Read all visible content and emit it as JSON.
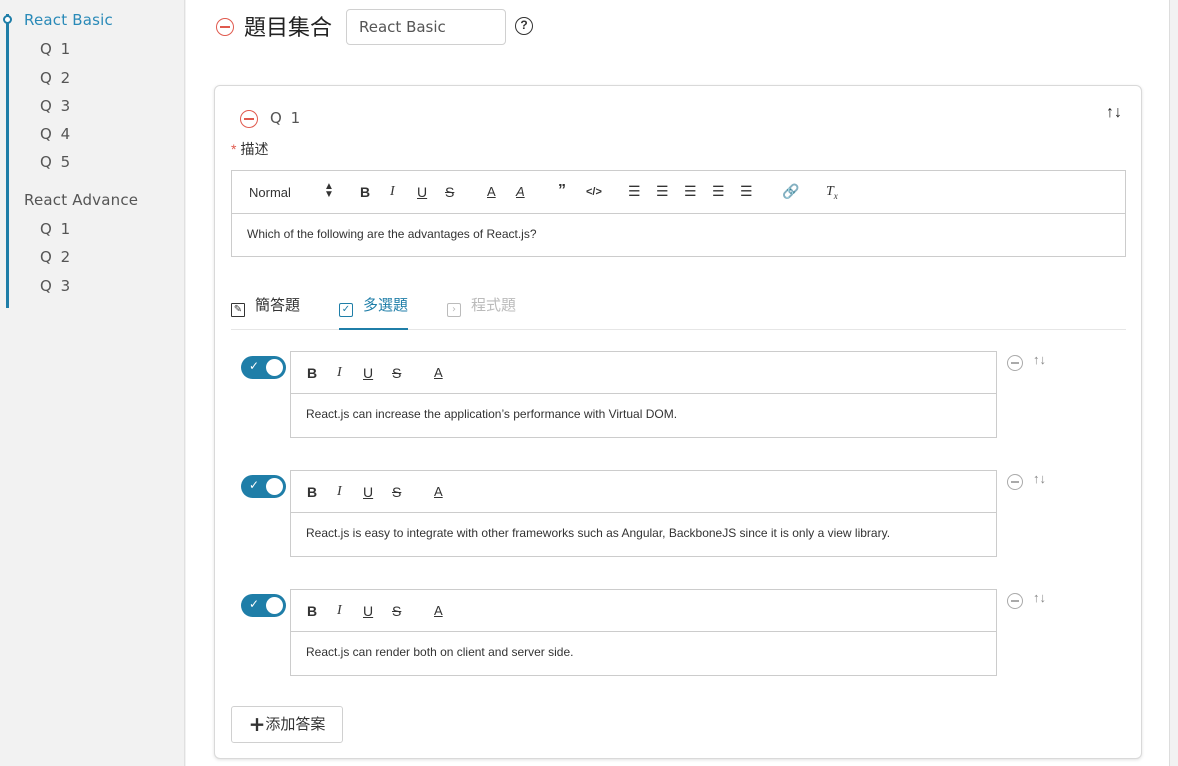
{
  "sidebar": {
    "sets": [
      {
        "label": "React Basic",
        "questions": [
          "Q 1",
          "Q 2",
          "Q 3",
          "Q 4",
          "Q 5"
        ]
      },
      {
        "label": "React Advance",
        "questions": [
          "Q 1",
          "Q 2",
          "Q 3"
        ]
      }
    ]
  },
  "header": {
    "title": "題目集合",
    "set_name_value": "React Basic",
    "help_symbol": "?"
  },
  "question": {
    "label": "Q 1",
    "description_label": "描述",
    "required_mark": "*",
    "sort_symbol": "↑↓",
    "editor": {
      "format_select": "Normal",
      "content": "Which of the following are the advantages of React.js?"
    }
  },
  "tabs": [
    {
      "label": "簡答題",
      "icon": "edit-icon",
      "state": "normal"
    },
    {
      "label": "多選題",
      "icon": "checkbox-icon",
      "state": "active"
    },
    {
      "label": "程式題",
      "icon": "terminal-icon",
      "state": "disabled"
    }
  ],
  "answers": [
    {
      "enabled": true,
      "text": "React.js can increase the application’s performance with Virtual DOM."
    },
    {
      "enabled": true,
      "text": "React.js is easy to integrate with other frameworks such as Angular, BackboneJS since it is only a view library."
    },
    {
      "enabled": true,
      "text": "React.js can render both on client and server side."
    }
  ],
  "add_answer_label": "添加答案",
  "colors": {
    "accent": "#1f7ea8",
    "danger": "#e05a4e"
  }
}
